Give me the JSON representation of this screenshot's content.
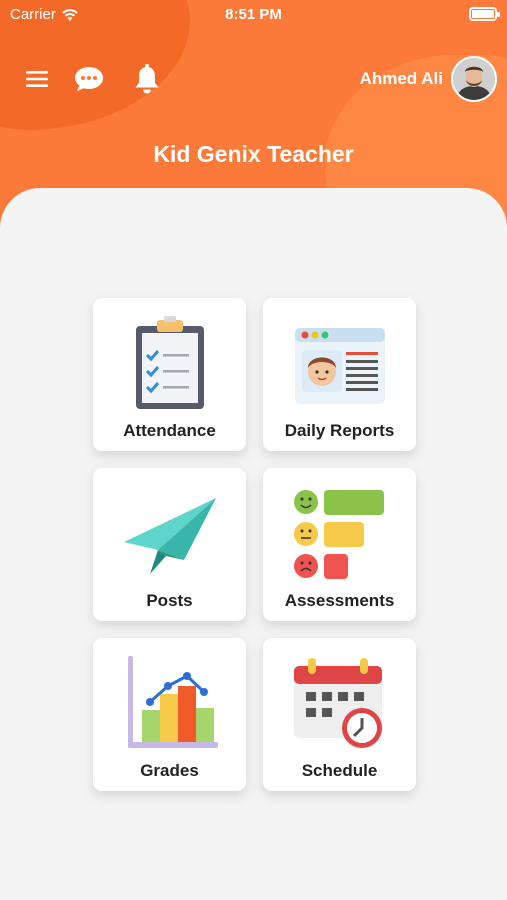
{
  "status_bar": {
    "carrier": "Carrier",
    "time": "8:51 PM"
  },
  "header": {
    "title": "Kid Genix Teacher",
    "user_name": "Ahmed Ali",
    "accent_color": "#fb7a39"
  },
  "icons": {
    "menu": "menu-icon",
    "chat": "chat-icon",
    "notifications": "bell-icon"
  },
  "tiles": [
    {
      "label": "Attendance",
      "icon": "clipboard-checklist-icon"
    },
    {
      "label": "Daily Reports",
      "icon": "report-card-icon"
    },
    {
      "label": "Posts",
      "icon": "paper-plane-icon"
    },
    {
      "label": "Assessments",
      "icon": "assessment-faces-icon"
    },
    {
      "label": "Grades",
      "icon": "bar-chart-icon"
    },
    {
      "label": "Schedule",
      "icon": "calendar-clock-icon"
    }
  ]
}
